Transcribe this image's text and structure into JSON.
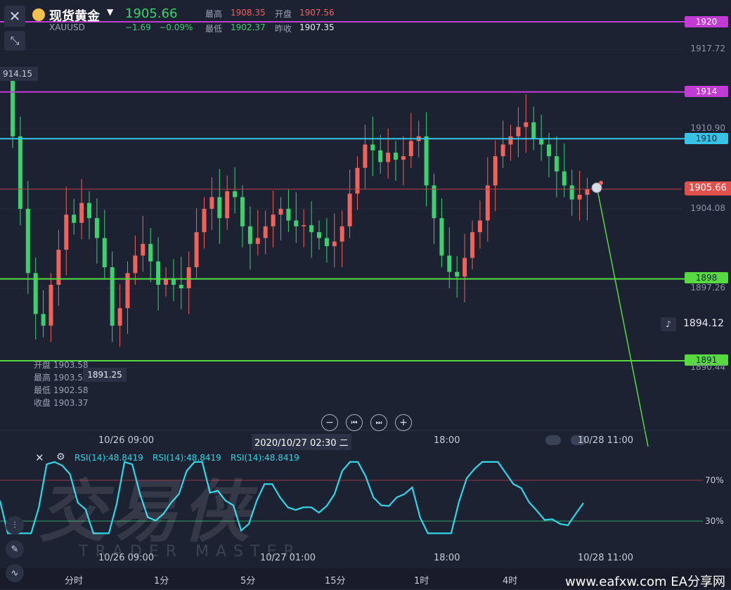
{
  "header": {
    "close_icon": "close-icon",
    "expand_icon": "collapse-arrows-icon",
    "logo_icon": "gold-coins-icon",
    "title": "现货黄金",
    "dropdown_icon": "caret-down-icon",
    "price": "1905.66",
    "symbol": "XAUUSD",
    "change": "−1.69",
    "change_pct": "−0.09%",
    "high_label": "最高",
    "high_value": "1908.35",
    "open_label": "开盘",
    "open_value": "1907.56",
    "low_label": "最低",
    "low_value": "1902.37",
    "prev_close_label": "昨收",
    "prev_close_value": "1907.35"
  },
  "levels": [
    {
      "name": "1920",
      "price": 1920,
      "color": "#c23bd4"
    },
    {
      "name": "1914",
      "price": 1914,
      "color": "#c23bd4"
    },
    {
      "name": "1910",
      "price": 1910,
      "color": "#36c3e6"
    },
    {
      "name": "1898",
      "price": 1898,
      "color": "#57d940"
    },
    {
      "name": "1891",
      "price": 1891,
      "color": "#57d940"
    }
  ],
  "price_axis": [
    "1917.72",
    "1910.90",
    "1904.08",
    "1897.26",
    "1890.44"
  ],
  "current_price_tag": "1905.66",
  "left_partial_label": "914.15",
  "alert": {
    "icon": "bell-icon",
    "price": "1894.12"
  },
  "low_marker": "1891.25",
  "ohlc_tooltip": [
    {
      "label": "开盘",
      "value": "1903.58"
    },
    {
      "label": "最高",
      "value": "1903.5"
    },
    {
      "label": "最低",
      "value": "1902.58"
    },
    {
      "label": "收盘",
      "value": "1903.37"
    }
  ],
  "controls": [
    {
      "name": "zoom-out",
      "icon": "minus-icon",
      "glyph": "−"
    },
    {
      "name": "step-back",
      "icon": "skip-back-icon",
      "glyph": "⏮"
    },
    {
      "name": "step-forward",
      "icon": "skip-forward-icon",
      "glyph": "⏭"
    },
    {
      "name": "zoom-in",
      "icon": "plus-icon",
      "glyph": "+"
    }
  ],
  "time_axis": {
    "t1": "10/26 09:00",
    "cursor": "2020/10/27 02:30 二",
    "t3": "18:00",
    "t4": "10/28 11:00"
  },
  "rsi": {
    "labels": [
      "RSI(14):48.8419",
      "RSI(14):48.8419",
      "RSI(14):48.8419"
    ],
    "level_70": "70%",
    "level_30": "30%",
    "time_axis": {
      "t1": "10/26 09:00",
      "t2": "10/27 01:00",
      "t3": "18:00",
      "t4": "10/28 11:00"
    }
  },
  "timeframes": [
    "分时",
    "1分",
    "5分",
    "15分",
    "1时",
    "4时"
  ],
  "watermark": {
    "zh": "交易侠",
    "en": "TRADER MASTER"
  },
  "footer_brand": "www.eafxw.com  EA分享网",
  "colors": {
    "up": "#f0625a",
    "down": "#3bd16f",
    "rsi": "#2fd6e8",
    "bg": "#1d2233"
  },
  "chart_data": {
    "type": "candlestick",
    "ylim": [
      1887,
      1922
    ],
    "closes": [
      1910.2,
      1904,
      1898.5,
      1895,
      1894,
      1897.5,
      1900.5,
      1903.5,
      1902.8,
      1904.5,
      1903.2,
      1901.5,
      1899,
      1894,
      1895.5,
      1898.5,
      1900,
      1901,
      1899.5,
      1897.5,
      1898,
      1897.5,
      1897.2,
      1899,
      1902,
      1904,
      1905,
      1903.2,
      1905.5,
      1905,
      1902.5,
      1901,
      1901.5,
      1902.5,
      1903.5,
      1904,
      1903,
      1902.5,
      1902.6,
      1902,
      1901.5,
      1900.8,
      1901.2,
      1902.5,
      1905.3,
      1907.5,
      1909.5,
      1909,
      1908,
      1908.8,
      1908.2,
      1908.5,
      1909.8,
      1910.2,
      1906,
      1903.2,
      1900,
      1898.6,
      1898.2,
      1899.8,
      1902,
      1903,
      1906,
      1908.5,
      1909.5,
      1910.2,
      1911,
      1911.4,
      1910,
      1909.5,
      1908.5,
      1907.2,
      1906,
      1904.8,
      1905.2,
      1905.66
    ]
  }
}
